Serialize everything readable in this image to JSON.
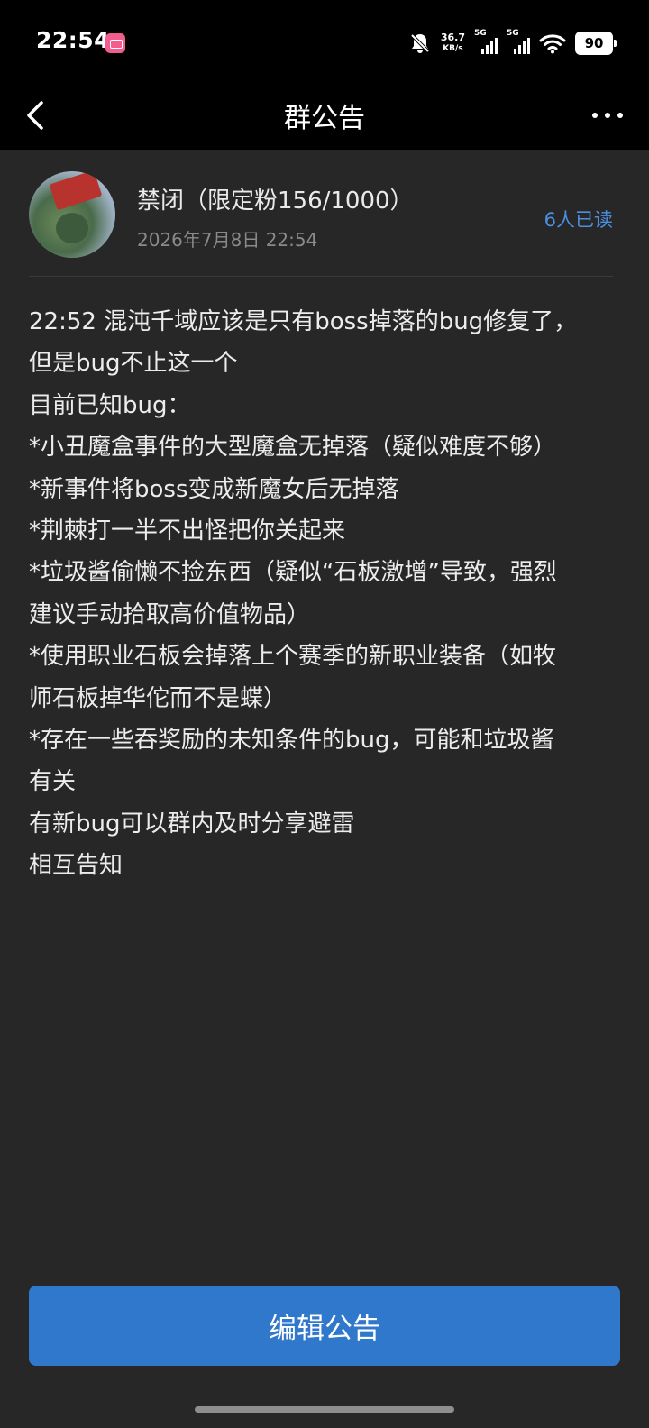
{
  "status_bar": {
    "time": "22:54",
    "net_speed": "36.7",
    "net_speed_unit": "KB/s",
    "signal1_label": "5G",
    "signal2_label": "5G",
    "battery": "90"
  },
  "nav": {
    "title": "群公告"
  },
  "notice": {
    "author": "禁闭（限定粉156/1000）",
    "time": "2026年7月8日 22:54",
    "read_count": "6人已读",
    "lines": [
      "22:52 混沌千域应该是只有boss掉落的bug修复了，",
      "但是bug不止这一个",
      "目前已知bug：",
      "*小丑魔盒事件的大型魔盒无掉落（疑似难度不够）",
      "*新事件将boss变成新魔女后无掉落",
      "*荆棘打一半不出怪把你关起来",
      "*垃圾酱偷懒不捡东西（疑似“石板激增”导致，强烈",
      "建议手动拾取高价值物品）",
      "*使用职业石板会掉落上个赛季的新职业装备（如牧",
      "师石板掉华佗而不是蝶）",
      "*存在一些吞奖励的未知条件的bug，可能和垃圾酱",
      "有关",
      "有新bug可以群内及时分享避雷",
      "相互告知"
    ]
  },
  "footer": {
    "edit_label": "编辑公告"
  },
  "colors": {
    "background": "#272727",
    "header": "#000000",
    "accent": "#2f78cc",
    "read_count": "#4c8fe0"
  }
}
